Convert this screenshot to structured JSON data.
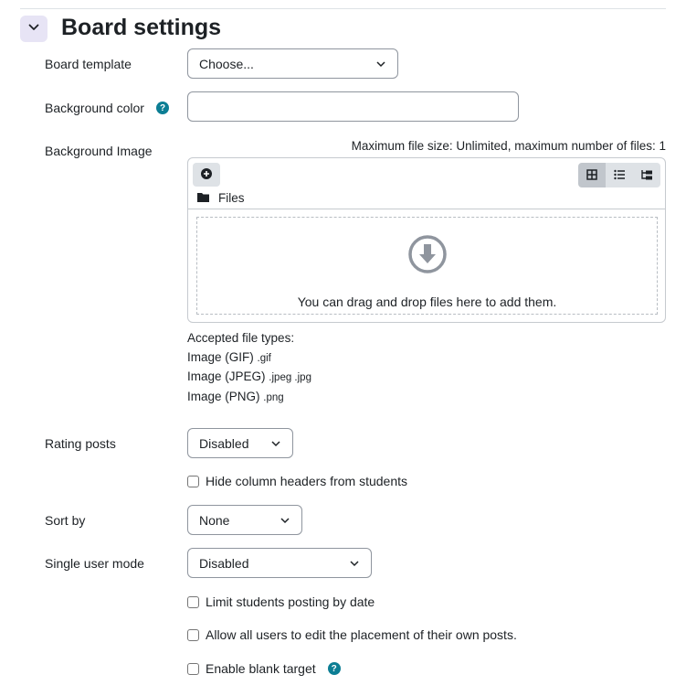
{
  "section": {
    "title": "Board settings"
  },
  "board_template": {
    "label": "Board template",
    "selected": "Choose..."
  },
  "background_color": {
    "label": "Background color",
    "value": ""
  },
  "background_image": {
    "label": "Background Image",
    "max_size_text": "Maximum file size: Unlimited, maximum number of files: 1",
    "files_label": "Files",
    "drop_text": "You can drag and drop files here to add them.",
    "accepted_title": "Accepted file types:",
    "types": [
      {
        "name": "Image (GIF)",
        "ext": ".gif"
      },
      {
        "name": "Image (JPEG)",
        "ext": ".jpeg .jpg"
      },
      {
        "name": "Image (PNG)",
        "ext": ".png"
      }
    ]
  },
  "rating_posts": {
    "label": "Rating posts",
    "selected": "Disabled"
  },
  "hide_headers": {
    "label": "Hide column headers from students",
    "checked": false
  },
  "sort_by": {
    "label": "Sort by",
    "selected": "None"
  },
  "single_user_mode": {
    "label": "Single user mode",
    "selected": "Disabled"
  },
  "limit_posting": {
    "label": "Limit students posting by date",
    "checked": false
  },
  "allow_edit_placement": {
    "label": "Allow all users to edit the placement of their own posts.",
    "checked": false
  },
  "blank_target": {
    "label": "Enable blank target",
    "checked": false
  },
  "colors": {
    "accent": "#0f6cbf",
    "help": "#0c7e94",
    "collapse_bg": "#e7e4f5"
  }
}
